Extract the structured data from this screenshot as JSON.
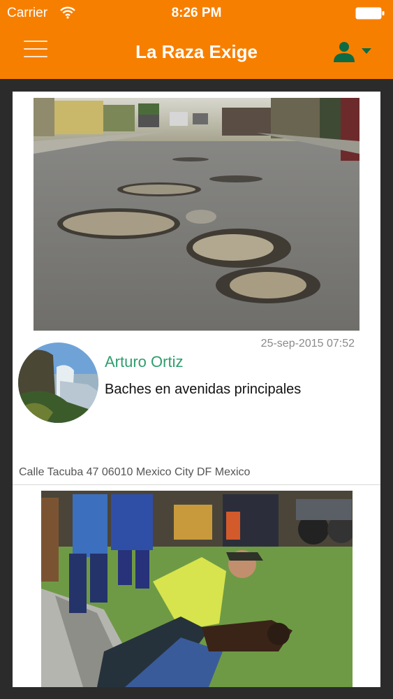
{
  "status_bar": {
    "carrier": "Carrier",
    "time": "8:26 PM"
  },
  "nav": {
    "title": "La Raza Exige",
    "menu_icon": "hamburger-menu-icon",
    "user_icon": "user-dropdown-icon"
  },
  "colors": {
    "brand": "#f77f00",
    "author": "#2e9e6e",
    "background": "#2b2b2b"
  },
  "posts": [
    {
      "timestamp": "25-sep-2015 07:52",
      "author": "Arturo Ortiz",
      "title": "Baches en avenidas principales",
      "address": "Calle Tacuba 47 06010 Mexico City DF Mexico"
    }
  ]
}
